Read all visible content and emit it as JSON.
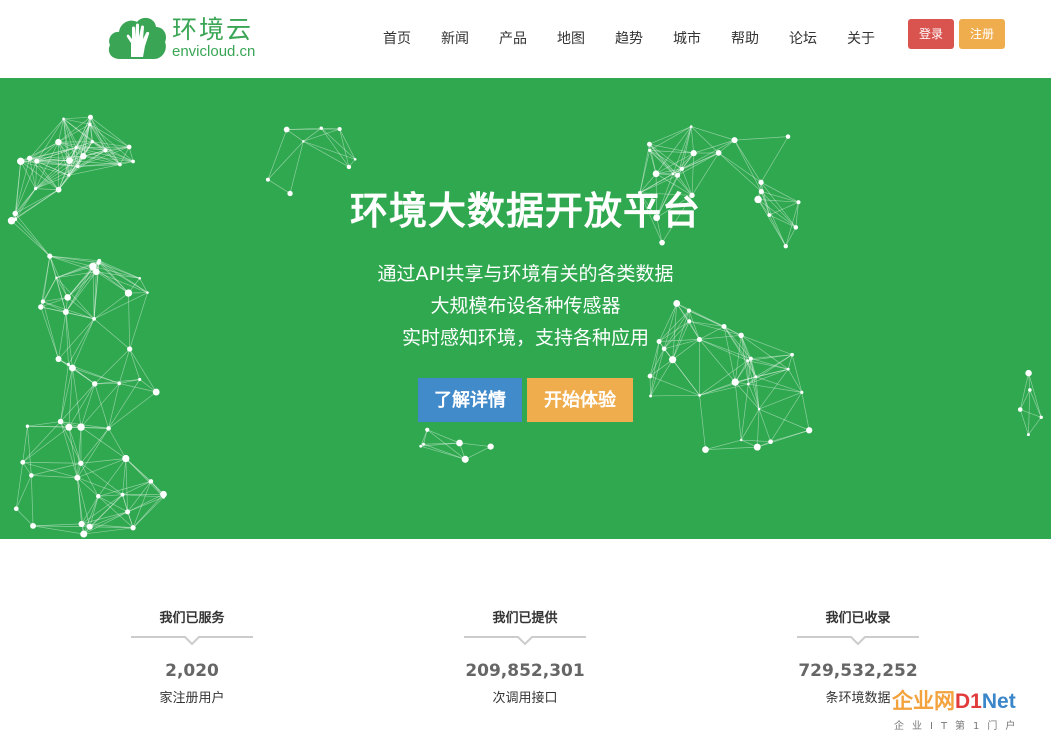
{
  "brand": {
    "name_cn": "环境云",
    "name_en": "envicloud.cn",
    "color": "#3aa655"
  },
  "nav": {
    "items": [
      "首页",
      "新闻",
      "产品",
      "地图",
      "趋势",
      "城市",
      "帮助",
      "论坛",
      "关于"
    ]
  },
  "auth": {
    "login_label": "登录",
    "register_label": "注册"
  },
  "hero": {
    "title": "环境大数据开放平台",
    "lines": [
      "通过API共享与环境有关的各类数据",
      "大规模布设各种传感器",
      "实时感知环境，支持各种应用"
    ],
    "detail_button": "了解详情",
    "try_button": "开始体验",
    "background": "#2fa84f"
  },
  "stats": [
    {
      "heading": "我们已服务",
      "value": "2,020",
      "label": "家注册用户"
    },
    {
      "heading": "我们已提供",
      "value": "209,852,301",
      "label": "次调用接口"
    },
    {
      "heading": "我们已收录",
      "value": "729,532,252",
      "label": "条环境数据"
    }
  ],
  "watermark": {
    "cn": "企业网",
    "d": "D1",
    "net": "Net",
    "sub": "企业IT第1门户"
  },
  "colors": {
    "login": "#d9534f",
    "register": "#f0ad4e",
    "detail": "#428bca",
    "try": "#f0ad4e"
  }
}
